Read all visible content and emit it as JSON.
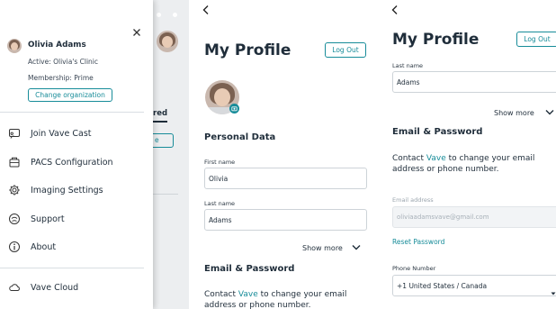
{
  "drawer": {
    "user_name": "Olivia Adams",
    "active": "Active: Olivia's Clinic",
    "membership": "Membership: Prime",
    "change_org_label": "Change organization",
    "close_icon": "close-icon",
    "menu": [
      {
        "label": "Join Vave Cast",
        "icon": "cast-icon"
      },
      {
        "label": "PACS Configuration",
        "icon": "pacs-icon"
      },
      {
        "label": "Imaging Settings",
        "icon": "gear-icon"
      },
      {
        "label": "Support",
        "icon": "support-icon"
      },
      {
        "label": "About",
        "icon": "info-icon"
      }
    ],
    "cloud_label": "Vave Cloud",
    "background_fragments": {
      "tab_text": "red",
      "button_text": "e"
    }
  },
  "profile_left": {
    "title": "My Profile",
    "logout_label": "Log Out",
    "personal_data_heading": "Personal Data",
    "first_name_label": "First name",
    "first_name_value": "Olivia",
    "last_name_label": "Last name",
    "last_name_value": "Adams",
    "show_more_label": "Show more",
    "email_password_heading": "Email & Password",
    "contact_prefix": "Contact ",
    "contact_brand": "Vave",
    "contact_suffix": " to change your email",
    "contact_line2": "address or phone number."
  },
  "profile_right": {
    "title": "My Profile",
    "logout_label": "Log Out",
    "last_name_label": "Last name",
    "last_name_value": "Adams",
    "show_more_label": "Show more",
    "email_password_heading": "Email & Password",
    "contact_prefix": "Contact ",
    "contact_brand": "Vave",
    "contact_suffix": " to change your email",
    "contact_line2": "address or phone number.",
    "email_label": "Email address",
    "email_placeholder": "oliviaadamsvave@gmail.com",
    "reset_password_label": "Reset Password",
    "phone_label": "Phone Number",
    "phone_country": "+1 United States / Canada"
  },
  "colors": {
    "accent": "#178c99",
    "text": "#1f2d3a",
    "divider": "#d9dee3"
  }
}
